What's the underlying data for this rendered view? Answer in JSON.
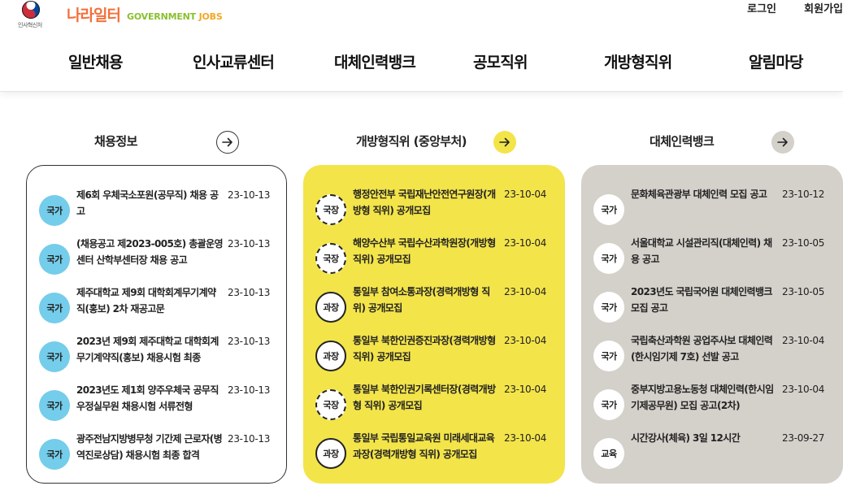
{
  "header": {
    "emblem_caption": "인사혁신처",
    "brand_ko": "나라일터",
    "brand_en_1": "GOVERNMENT ",
    "brand_en_2": "JOBS",
    "login": "로그인",
    "join": "회원가입"
  },
  "nav": [
    "일반채용",
    "인사교류센터",
    "대체인력뱅크",
    "공모직위",
    "개방형직위",
    "알림마당"
  ],
  "sections": [
    {
      "title": "채용정보",
      "items": [
        {
          "badge": "국가",
          "title": "제6회 우체국소포원(공무직) 채용 공고",
          "date": "23-10-13"
        },
        {
          "badge": "국가",
          "title": "(채용공고 제2023-005호) 총괄운영센터 산학부센터장 채용 공고",
          "date": "23-10-13"
        },
        {
          "badge": "국가",
          "title": "제주대학교 제9회 대학회계무기계약직(홍보) 2차 재공고문",
          "date": "23-10-13"
        },
        {
          "badge": "국가",
          "title": "2023년 제9회 제주대학교 대학회계무기계약직(홍보) 채용시험 최종",
          "date": "23-10-13"
        },
        {
          "badge": "국가",
          "title": "2023년도 제1회 양주우체국 공무직 우정실무원 채용시험 서류전형",
          "date": "23-10-13"
        },
        {
          "badge": "국가",
          "title": "광주전남지방병무청 기간제 근로자(병역진로상담) 채용시험 최종 합격",
          "date": "23-10-13"
        }
      ]
    },
    {
      "title": "개방형직위 (중앙부처)",
      "items": [
        {
          "badge": "국장",
          "title": "행정안전부 국립재난안전연구원장(개방형 직위) 공개모집",
          "date": "23-10-04"
        },
        {
          "badge": "국장",
          "title": "해양수산부 국립수산과학원장(개방형 직위) 공개모집",
          "date": "23-10-04"
        },
        {
          "badge": "과장",
          "title": "통일부 참여소통과장(경력개방형 직위) 공개모집",
          "date": "23-10-04"
        },
        {
          "badge": "과장",
          "title": "통일부 북한인권증진과장(경력개방형 직위) 공개모집",
          "date": "23-10-04"
        },
        {
          "badge": "국장",
          "title": "통일부 북한인권기록센터장(경력개방형 직위) 공개모집",
          "date": "23-10-04"
        },
        {
          "badge": "과장",
          "title": "통일부 국립통일교육원 미래세대교육과장(경력개방형 직위) 공개모집",
          "date": "23-10-04"
        }
      ]
    },
    {
      "title": "대체인력뱅크",
      "items": [
        {
          "badge": "국가",
          "title": "문화체육관광부 대체인력 모집 공고",
          "date": "23-10-12"
        },
        {
          "badge": "국가",
          "title": "서울대학교 시설관리직(대체인력) 채용 공고",
          "date": "23-10-05"
        },
        {
          "badge": "국가",
          "title": "2023년도 국립국어원 대체인력뱅크 모집 공고",
          "date": "23-10-05"
        },
        {
          "badge": "국가",
          "title": "국립축산과학원 공업주사보 대체인력(한시임기제 7호) 선발 공고",
          "date": "23-10-04"
        },
        {
          "badge": "국가",
          "title": "중부지방고용노동청 대체인력(한시임기제공무원) 모집 공고(2차)",
          "date": "23-10-04"
        },
        {
          "badge": "교육",
          "title": "시간강사(체육) 3일 12시간",
          "date": "23-09-27"
        }
      ]
    }
  ],
  "colors": {
    "brand_orange": "#f2703a",
    "brand_green": "#8bbf2f",
    "badge_blue": "#74cdea",
    "panel_yellow": "#f3e44a",
    "panel_gray": "#d4d0ca"
  },
  "icons": [
    "taegeuk-emblem-icon",
    "arrow-right-icon"
  ]
}
